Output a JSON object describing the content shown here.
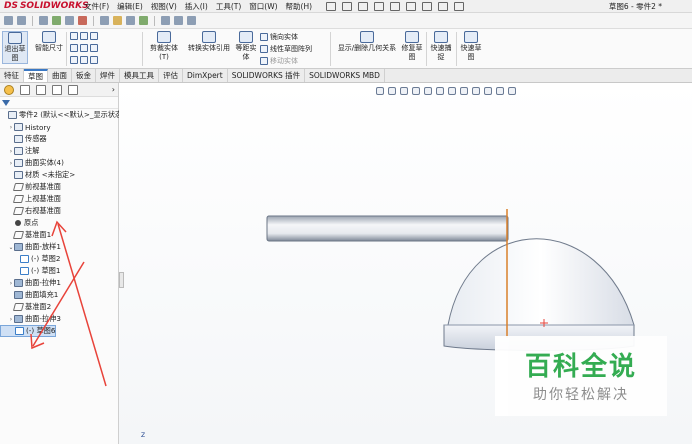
{
  "app": {
    "logo": "SOLIDWORKS",
    "document_title": "草图6 - 零件2 *"
  },
  "menu": [
    "文件(F)",
    "编辑(E)",
    "视图(V)",
    "插入(I)",
    "工具(T)",
    "窗口(W)",
    "帮助(H)"
  ],
  "command_manager": {
    "large": [
      {
        "label": "退出草图",
        "icon": "exit-sketch-icon"
      },
      {
        "label": "智能尺寸",
        "icon": "smart-dimension-icon"
      },
      {
        "label": "剪裁实体(T)",
        "icon": "trim-entities-icon"
      },
      {
        "label": "转换实体引用",
        "icon": "convert-entities-icon"
      },
      {
        "label": "等距实体",
        "icon": "offset-entities-icon"
      },
      {
        "label": "显示/删除几何关系",
        "icon": "relations-icon"
      },
      {
        "label": "修复草图",
        "icon": "repair-sketch-icon"
      },
      {
        "label": "快速捕捉",
        "icon": "quick-snaps-icon"
      },
      {
        "label": "快速草图",
        "icon": "rapid-sketch-icon"
      }
    ],
    "small": [
      {
        "label": "镜向实体",
        "disabled": false
      },
      {
        "label": "线性草图阵列",
        "disabled": false
      },
      {
        "label": "移动实体",
        "disabled": true
      }
    ]
  },
  "tabs": [
    "特征",
    "草图",
    "曲面",
    "钣金",
    "焊件",
    "模具工具",
    "评估",
    "DimXpert",
    "SOLIDWORKS 插件",
    "SOLIDWORKS MBD"
  ],
  "active_tab": "草图",
  "feature_tree": [
    {
      "label": "零件2 (默认<<默认>_显示状态",
      "indent": 0,
      "icon": "part",
      "expand": ""
    },
    {
      "label": "History",
      "indent": 1,
      "icon": "folder",
      "expand": "›"
    },
    {
      "label": "传感器",
      "indent": 1,
      "icon": "folder",
      "expand": ""
    },
    {
      "label": "注解",
      "indent": 1,
      "icon": "folder",
      "expand": "›"
    },
    {
      "label": "曲面实体(4)",
      "indent": 1,
      "icon": "folder",
      "expand": "›"
    },
    {
      "label": "材质 <未指定>",
      "indent": 1,
      "icon": "material",
      "expand": ""
    },
    {
      "label": "前视基准面",
      "indent": 1,
      "icon": "plane",
      "expand": ""
    },
    {
      "label": "上视基准面",
      "indent": 1,
      "icon": "plane",
      "expand": ""
    },
    {
      "label": "右视基准面",
      "indent": 1,
      "icon": "plane",
      "expand": ""
    },
    {
      "label": "原点",
      "indent": 1,
      "icon": "origin",
      "expand": ""
    },
    {
      "label": "基准面1",
      "indent": 1,
      "icon": "plane",
      "expand": ""
    },
    {
      "label": "曲面-放样1",
      "indent": 1,
      "icon": "surface",
      "expand": "⌄"
    },
    {
      "label": "(-) 草图2",
      "indent": 2,
      "icon": "sketch",
      "expand": ""
    },
    {
      "label": "(-) 草图1",
      "indent": 2,
      "icon": "sketch",
      "expand": ""
    },
    {
      "label": "曲面-拉伸1",
      "indent": 1,
      "icon": "surface",
      "expand": "›"
    },
    {
      "label": "曲面填充1",
      "indent": 1,
      "icon": "surface",
      "expand": ""
    },
    {
      "label": "基准面2",
      "indent": 1,
      "icon": "plane",
      "expand": ""
    },
    {
      "label": "曲面-拉伸3",
      "indent": 1,
      "icon": "surface",
      "expand": "›"
    },
    {
      "label": "(-) 草图6",
      "indent": 1,
      "icon": "sketch",
      "expand": "",
      "selected": true
    }
  ],
  "origin_label": "Z",
  "watermark": {
    "title": "百科全说",
    "subtitle": "助你轻松解决"
  },
  "colors": {
    "accent": "#3a78c4",
    "annotation_arrow": "#e8433a",
    "sketch_line": "#d9802a",
    "logo": "#c8102e",
    "watermark": "#2aa84a"
  }
}
